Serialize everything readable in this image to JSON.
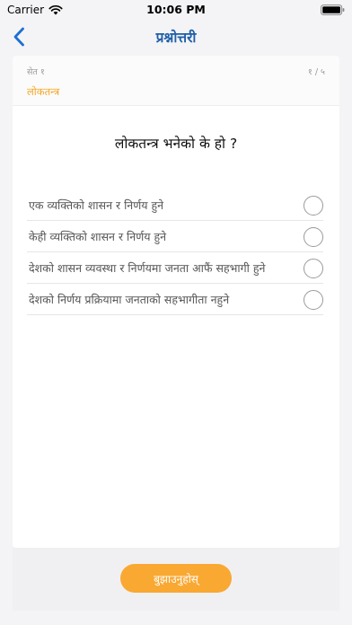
{
  "status_bar": {
    "carrier": "Carrier",
    "time": "10:06 PM",
    "wifi_icon": "wifi-icon",
    "battery_icon": "battery-icon"
  },
  "nav": {
    "back_icon": "chevron-left-icon",
    "title": "प्रश्नोत्तरी"
  },
  "quiz": {
    "set_label": "सेत १",
    "progress": "१ / ५",
    "topic": "लोकतन्त्र",
    "question": "लोकतन्त्र भनेको के हो ?",
    "options": [
      {
        "label": "एक व्यक्तिको शासन र निर्णय हुने",
        "selected": false
      },
      {
        "label": "केही व्यक्तिको शासन र निर्णय हुने",
        "selected": false
      },
      {
        "label": "देशको शासन व्यवस्था र  निर्णयमा जनता आफैं सहभागी हुने",
        "selected": false
      },
      {
        "label": "देशको निर्णय प्रक्रियामा जनताको सहभागीता नहुने",
        "selected": false
      }
    ]
  },
  "submit_label": "बुझाउनुहोस्",
  "colors": {
    "accent_blue": "#1f5fa8",
    "accent_orange": "#f5a623",
    "button_orange": "#f9a832"
  }
}
